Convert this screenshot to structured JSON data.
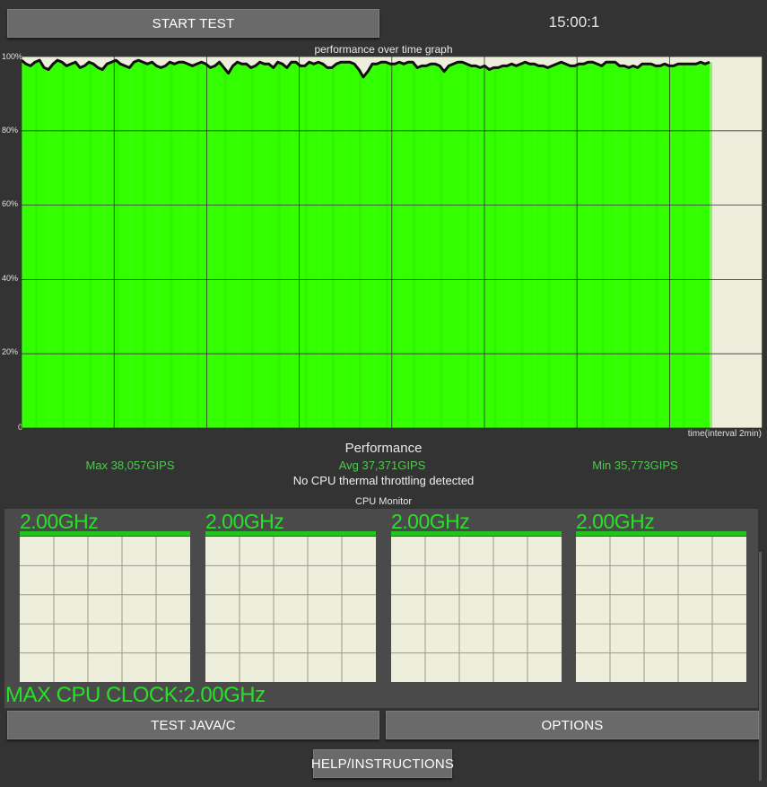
{
  "toolbar": {
    "start_label": "START TEST",
    "clock": "15:00:1"
  },
  "graph": {
    "title": "performance over time graph",
    "y_ticks": [
      "100%",
      "80%",
      "60%",
      "40%",
      "20%",
      "0"
    ],
    "x_label": "time(interval 2min)",
    "fill_color": "#33ff00",
    "background_color": "#eeeedc",
    "line_color": "#111111"
  },
  "chart_data": {
    "type": "area",
    "title": "performance over time graph",
    "xlabel": "time(interval 2min)",
    "ylabel": "",
    "ylim": [
      0,
      100
    ],
    "y_ticks": [
      0,
      20,
      40,
      60,
      80,
      100
    ],
    "grid": true,
    "x": [
      0,
      1,
      2,
      3,
      4,
      5,
      6,
      7,
      8,
      9,
      10,
      11,
      12,
      13,
      14,
      15,
      16,
      17,
      18,
      19,
      20,
      21,
      22,
      23,
      24,
      25,
      26,
      27,
      28,
      29,
      30,
      31,
      32,
      33,
      34,
      35,
      36,
      37,
      38,
      39,
      40,
      41,
      42,
      43,
      44,
      45,
      46,
      47,
      48,
      49,
      50,
      51,
      52,
      53,
      54,
      55,
      56,
      57,
      58,
      59,
      60,
      61,
      62,
      63,
      64,
      65,
      66,
      67,
      68,
      69,
      70,
      71,
      72,
      73,
      74,
      75,
      76,
      77,
      78,
      79,
      80,
      81,
      82,
      83,
      84,
      85,
      86,
      87,
      88,
      89,
      90,
      91,
      92,
      93,
      94,
      95,
      96,
      97,
      98,
      99,
      100,
      101,
      102,
      103,
      104,
      105,
      106,
      107,
      108,
      109,
      110,
      111,
      112,
      113,
      114,
      115,
      116,
      117,
      118,
      119,
      120,
      121,
      122,
      123,
      124,
      125,
      126,
      127,
      128,
      129,
      130,
      131,
      132,
      133,
      134,
      135,
      136,
      137,
      138,
      139,
      140,
      141,
      142,
      143,
      144,
      145,
      146,
      147,
      148,
      149
    ],
    "series": [
      {
        "values": [
          99.0,
          98.0,
          97.5,
          98.5,
          99.0,
          97.0,
          96.5,
          98.0,
          99.0,
          98.5,
          97.5,
          98.0,
          98.5,
          97.0,
          97.5,
          98.5,
          98.0,
          97.0,
          96.5,
          98.0,
          98.5,
          99.0,
          98.0,
          97.5,
          97.0,
          98.5,
          99.0,
          98.5,
          98.0,
          98.5,
          97.5,
          97.0,
          97.5,
          98.5,
          98.0,
          98.5,
          98.5,
          98.0,
          97.5,
          98.0,
          98.5,
          98.0,
          97.0,
          97.5,
          98.5,
          97.0,
          95.5,
          97.5,
          98.5,
          98.0,
          98.0,
          97.0,
          97.5,
          98.5,
          98.0,
          98.0,
          97.0,
          98.5,
          98.0,
          97.0,
          98.5,
          98.5,
          97.5,
          97.5,
          98.5,
          98.0,
          98.5,
          98.0,
          97.0,
          97.0,
          98.0,
          98.5,
          98.5,
          98.5,
          98.0,
          96.5,
          94.5,
          96.0,
          98.0,
          98.0,
          98.5,
          98.5,
          98.0,
          98.0,
          98.5,
          98.0,
          98.5,
          98.5,
          97.0,
          97.5,
          97.5,
          98.0,
          98.0,
          97.5,
          96.0,
          97.5,
          98.0,
          98.5,
          98.5,
          98.0,
          97.5,
          97.5,
          97.0,
          97.5,
          96.5,
          97.0,
          97.0,
          97.5,
          97.5,
          98.0,
          97.5,
          98.0,
          98.5,
          98.0,
          98.0,
          97.5,
          97.5,
          97.0,
          97.5,
          98.0,
          98.5,
          98.0,
          97.5,
          97.5,
          98.0,
          98.0,
          98.5,
          98.5,
          98.0,
          97.5,
          98.5,
          98.5,
          98.5,
          97.5,
          97.5,
          97.0,
          97.5,
          97.0,
          98.0,
          98.0,
          98.0,
          97.5,
          97.5,
          98.0,
          97.5,
          97.5,
          98.0,
          98.0,
          98.0,
          98.0,
          98.0,
          98.5,
          98.0,
          98.5
        ]
      }
    ]
  },
  "performance": {
    "title": "Performance",
    "max": "Max 38,057GIPS",
    "avg": "Avg 37,371GIPS",
    "min": "Min 35,773GIPS",
    "throttling": "No CPU thermal throttling detected",
    "stat_color": "#4fc94f"
  },
  "cpu_monitor": {
    "title": "CPU Monitor",
    "cores": [
      {
        "freq": "2.00GHz",
        "load": 0
      },
      {
        "freq": "2.00GHz",
        "load": 0
      },
      {
        "freq": "2.00GHz",
        "load": 0
      },
      {
        "freq": "2.00GHz",
        "load": 0
      }
    ],
    "max_clock": "MAX CPU CLOCK:2.00GHz",
    "accent_color": "#28e028"
  },
  "buttons": {
    "test_java_c": "TEST JAVA/C",
    "options": "OPTIONS",
    "help": "HELP/INSTRUCTIONS"
  }
}
